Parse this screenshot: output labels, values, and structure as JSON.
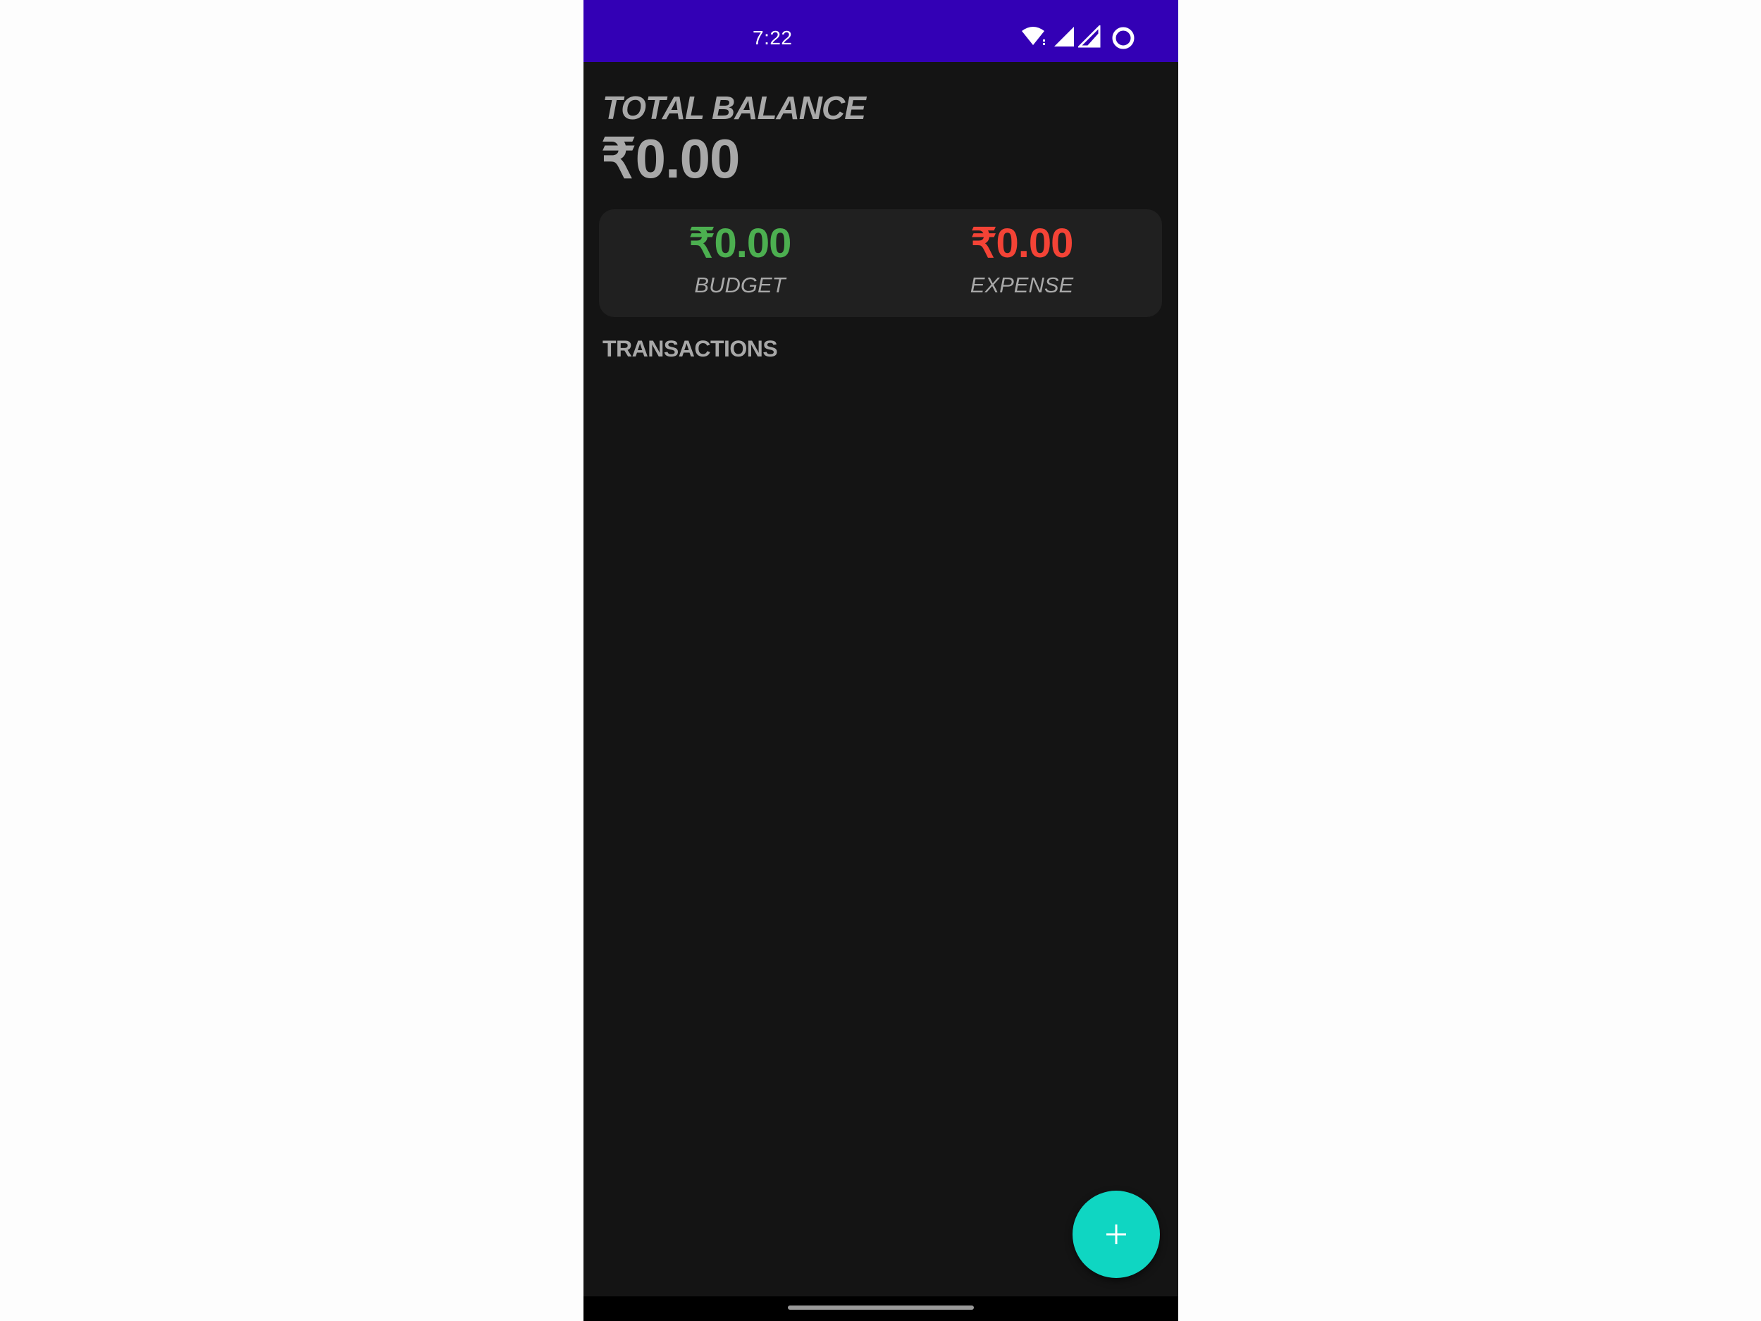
{
  "status_bar": {
    "time": "7:22",
    "background": "#3300b5",
    "icons": [
      "wifi-icon",
      "cellular-signal-icon",
      "cellular-signal-icon",
      "battery-ring-icon"
    ]
  },
  "balance": {
    "label": "TOTAL BALANCE",
    "amount": "₹0.00"
  },
  "summary": {
    "budget": {
      "amount": "₹0.00",
      "label": "BUDGET",
      "color": "#4caf50"
    },
    "expense": {
      "amount": "₹0.00",
      "label": "EXPENSE",
      "color": "#f44336"
    }
  },
  "transactions": {
    "header": "TRANSACTIONS",
    "items": []
  },
  "fab": {
    "icon": "plus-icon",
    "color": "#0fd6c2"
  },
  "theme": {
    "background": "#141414",
    "card": "#202020",
    "text_muted": "#a8a8a8"
  }
}
